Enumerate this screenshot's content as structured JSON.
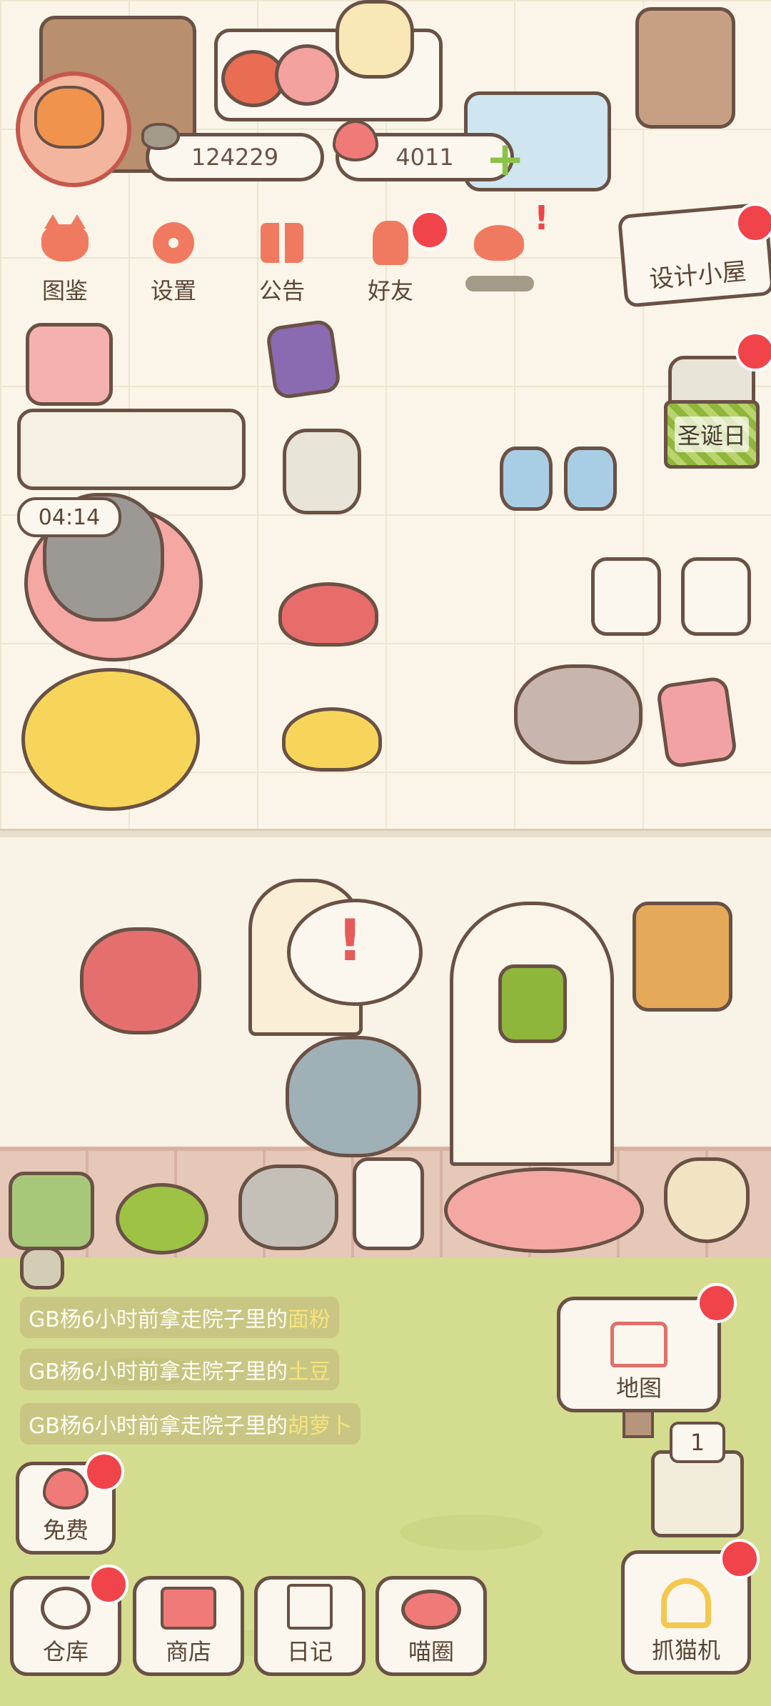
{
  "currency": {
    "fish": "124229",
    "hearts": "4011"
  },
  "top_nav": [
    {
      "label": "图鉴",
      "icon": "cat-book-icon"
    },
    {
      "label": "设置",
      "icon": "gear-icon"
    },
    {
      "label": "公告",
      "icon": "gift-icon"
    },
    {
      "label": "好友",
      "icon": "friends-icon"
    },
    {
      "label": "",
      "icon": "hearts-icon"
    }
  ],
  "design_house_label": "设计小屋",
  "christmas_label": "圣诞日",
  "timer": "04:14",
  "messages": [
    {
      "prefix": "GB杨6小时前拿走院子里的",
      "item": "面粉"
    },
    {
      "prefix": "GB杨6小时前拿走院子里的",
      "item": "土豆"
    },
    {
      "prefix": "GB杨6小时前拿走院子里的",
      "item": "胡萝卜"
    }
  ],
  "map_label": "地图",
  "gacha_count": "1",
  "free_label": "免费",
  "bottom_nav": [
    {
      "label": "仓库"
    },
    {
      "label": "商店"
    },
    {
      "label": "日记"
    },
    {
      "label": "喵圈"
    }
  ],
  "claw_machine_label": "抓猫机",
  "colors": {
    "notification": "#f0444a",
    "accent": "#f07a60",
    "outline": "#6a5145",
    "yard": "#d4dc8f"
  }
}
